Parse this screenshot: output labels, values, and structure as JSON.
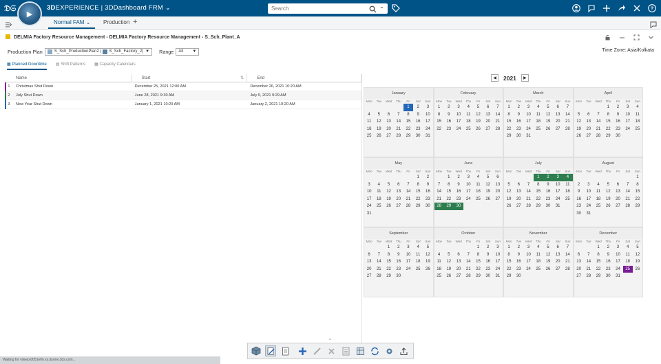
{
  "app": {
    "brand_prefix": "3D",
    "brand_name": "EXPERIENCE",
    "dashboard_name": " | 3DDashboard FRM",
    "search_placeholder": "Search"
  },
  "tabs": [
    {
      "label": "Normal FAM"
    },
    {
      "label": "Production"
    }
  ],
  "breadcrumb": "DELMIA Factory Resource Management - DELMIA Factory Resource Management - S_Sch_Plant_A",
  "production": {
    "label": "Production Plan",
    "plan_value": "S_Sch_ProductionPlan2 (",
    "factory_value": "S_Sch_Factory_2)",
    "range_label": "Range",
    "range_value": "All"
  },
  "timezone": "Time Zone: Asia/Kolkata",
  "subtabs": [
    {
      "label": "Planned Downtime"
    },
    {
      "label": "Shift Patterns"
    },
    {
      "label": "Capacity Calendars"
    }
  ],
  "grid": {
    "headers": [
      "Name",
      "Start",
      "End"
    ],
    "rows": [
      {
        "idx": "1",
        "name": "Christmas Shut Down",
        "start": "December 25, 2021 12:00 AM",
        "end": "December 26, 2021 10:20 AM",
        "color": "#8b1a9c"
      },
      {
        "idx": "2",
        "name": "July Shut Down",
        "start": "June 28, 2021 9:30 AM",
        "end": "July 5, 2021 9:29 AM",
        "color": "#2e7d4f"
      },
      {
        "idx": "3",
        "name": "New Year Shut Down",
        "start": "January 1, 2021 10:20 AM",
        "end": "January 2, 2021 10:20 AM",
        "color": "#2466b8"
      }
    ]
  },
  "calendar": {
    "year": "2021",
    "dow": [
      "Mon",
      "Tue",
      "Wed",
      "Thu",
      "Fri",
      "Sat",
      "Sun"
    ],
    "months": [
      {
        "name": "January",
        "offset": 4,
        "days": 31,
        "highlight": [
          1
        ],
        "hl": "blue"
      },
      {
        "name": "February",
        "offset": 0,
        "days": 28,
        "highlight": [],
        "hl": ""
      },
      {
        "name": "March",
        "offset": 0,
        "days": 31,
        "highlight": [],
        "hl": ""
      },
      {
        "name": "April",
        "offset": 3,
        "days": 30,
        "highlight": [],
        "hl": ""
      },
      {
        "name": "May",
        "offset": 5,
        "days": 31,
        "highlight": [],
        "hl": ""
      },
      {
        "name": "June",
        "offset": 1,
        "days": 30,
        "highlight": [
          28,
          29,
          30
        ],
        "hl": "green"
      },
      {
        "name": "July",
        "offset": 3,
        "days": 31,
        "highlight": [
          1,
          2,
          3,
          4
        ],
        "hl": "green"
      },
      {
        "name": "August",
        "offset": 6,
        "days": 31,
        "highlight": [],
        "hl": ""
      },
      {
        "name": "September",
        "offset": 2,
        "days": 30,
        "highlight": [],
        "hl": ""
      },
      {
        "name": "October",
        "offset": 4,
        "days": 31,
        "highlight": [],
        "hl": ""
      },
      {
        "name": "November",
        "offset": 0,
        "days": 30,
        "highlight": [],
        "hl": ""
      },
      {
        "name": "December",
        "offset": 2,
        "days": 31,
        "highlight": [
          25
        ],
        "hl": "purple"
      }
    ]
  },
  "statusbar": "Waiting for vdeeprd051efm.xx.dsone.3ds.com...",
  "colors": {
    "topbar": "#005386",
    "accent": "#005386",
    "new_year": "#2466b8",
    "july": "#2e7d4f",
    "christmas": "#7a1b95"
  }
}
